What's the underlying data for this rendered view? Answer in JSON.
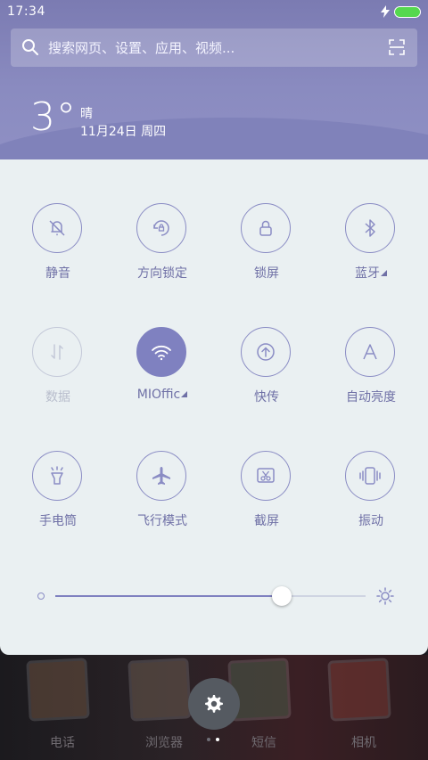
{
  "status": {
    "time": "17:34",
    "battery_color": "#55d84e"
  },
  "search": {
    "placeholder": "搜索网页、设置、应用、视频...",
    "icon": "search-icon",
    "scan_icon": "scan-icon"
  },
  "weather": {
    "temperature": "3°",
    "condition": "晴",
    "date": "11月24日 周四"
  },
  "toggles": [
    {
      "label": "静音",
      "icon": "bell-off-icon",
      "state": "off"
    },
    {
      "label": "方向锁定",
      "icon": "rotation-lock-icon",
      "state": "off"
    },
    {
      "label": "锁屏",
      "icon": "lock-icon",
      "state": "off"
    },
    {
      "label": "蓝牙",
      "icon": "bluetooth-icon",
      "state": "off",
      "has_more": true
    },
    {
      "label": "数据",
      "icon": "data-icon",
      "state": "disabled"
    },
    {
      "label": "MIOffic",
      "icon": "wifi-icon",
      "state": "on",
      "has_more": true
    },
    {
      "label": "快传",
      "icon": "quick-transfer-icon",
      "state": "off"
    },
    {
      "label": "自动亮度",
      "icon": "auto-brightness-icon",
      "state": "off"
    },
    {
      "label": "手电筒",
      "icon": "flashlight-icon",
      "state": "off"
    },
    {
      "label": "飞行模式",
      "icon": "airplane-icon",
      "state": "off"
    },
    {
      "label": "截屏",
      "icon": "screenshot-icon",
      "state": "off"
    },
    {
      "label": "振动",
      "icon": "vibrate-icon",
      "state": "off"
    }
  ],
  "brightness": {
    "level": 0.73
  },
  "dock": [
    {
      "label": "电话"
    },
    {
      "label": "浏览器"
    },
    {
      "label": "短信"
    },
    {
      "label": "相机"
    }
  ],
  "colors": {
    "accent": "#7f81c0",
    "panel": "#eaf0f2",
    "header": "#8a8bc0"
  },
  "page_indicator": {
    "pages": 2,
    "current": 2
  }
}
